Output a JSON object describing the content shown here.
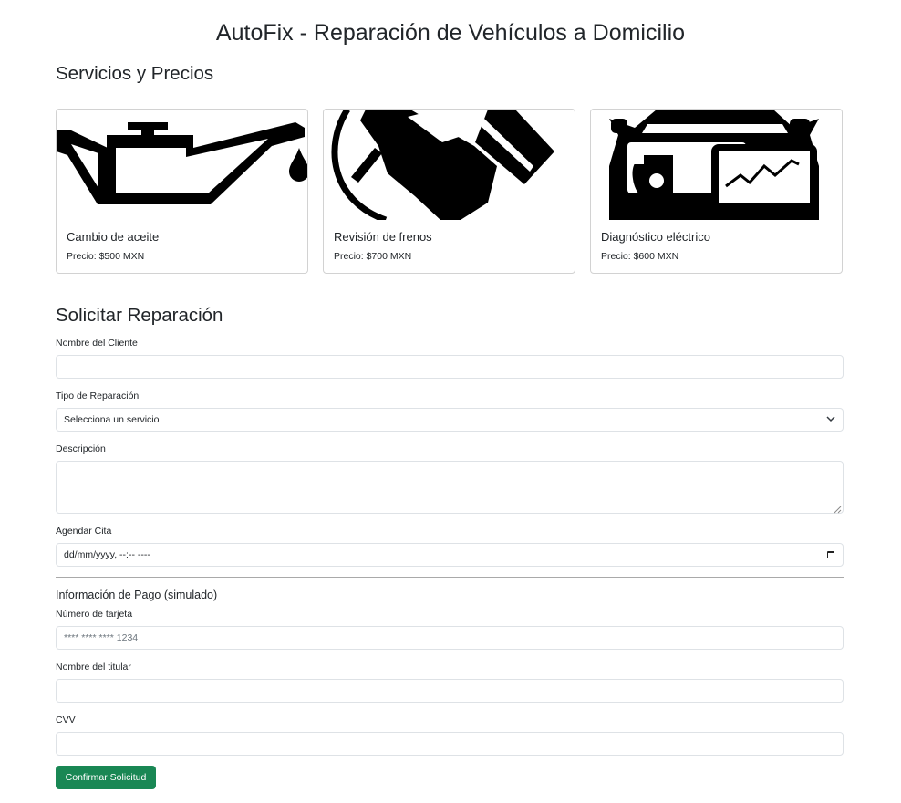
{
  "page": {
    "title": "AutoFix - Reparación de Vehículos a Domicilio"
  },
  "services": {
    "heading": "Servicios y Precios",
    "items": [
      {
        "title": "Cambio de aceite",
        "price": "Precio: $500 MXN",
        "icon": "oil-can-icon"
      },
      {
        "title": "Revisión de frenos",
        "price": "Precio: $700 MXN",
        "icon": "brake-check-icon"
      },
      {
        "title": "Diagnóstico eléctrico",
        "price": "Precio: $600 MXN",
        "icon": "car-diagnostic-icon"
      }
    ]
  },
  "form": {
    "heading": "Solicitar Reparación",
    "client_name": {
      "label": "Nombre del Cliente",
      "value": ""
    },
    "repair_type": {
      "label": "Tipo de Reparación",
      "selected": "Selecciona un servicio"
    },
    "description": {
      "label": "Descripción",
      "value": ""
    },
    "appointment": {
      "label": "Agendar Cita",
      "value": "dd/mm/yyyy, --:-- ----"
    }
  },
  "payment": {
    "heading": "Información de Pago (simulado)",
    "card_number": {
      "label": "Número de tarjeta",
      "placeholder": "**** **** **** 1234"
    },
    "holder_name": {
      "label": "Nombre del titular",
      "value": ""
    },
    "cvv": {
      "label": "CVV",
      "value": ""
    },
    "submit_label": "Confirmar Solicitud"
  },
  "colors": {
    "primary_button": "#198754",
    "text": "#212529",
    "border": "#dee2e6"
  }
}
